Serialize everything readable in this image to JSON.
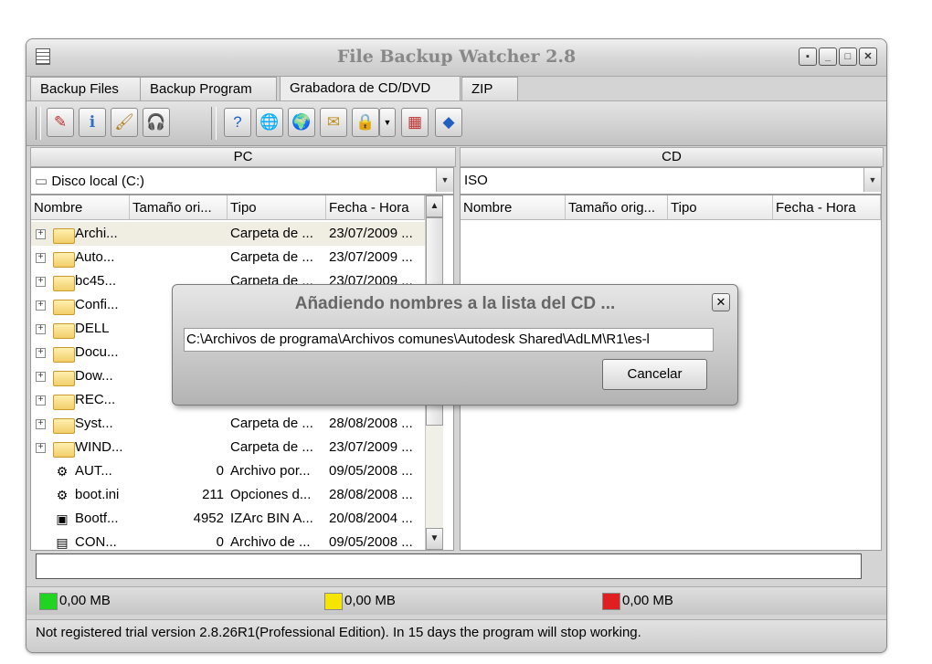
{
  "window": {
    "title": "File Backup Watcher 2.8"
  },
  "tabs": [
    "Backup Files",
    "Backup Program",
    "Grabadora de CD/DVD",
    "ZIP"
  ],
  "toolbar": {
    "buttons": [
      {
        "name": "burn-icon",
        "glyph": "✎",
        "color": "#c03030"
      },
      {
        "name": "info-icon",
        "glyph": "ℹ",
        "color": "#2f6fc0"
      },
      {
        "name": "brush-icon",
        "glyph": "🖌",
        "color": "#b08020"
      },
      {
        "name": "headset-icon",
        "glyph": "🎧",
        "color": "#3050b0"
      },
      {
        "name": "help-icon",
        "glyph": "?",
        "color": "#1f5fd0"
      },
      {
        "name": "globe-icon",
        "glyph": "🌐",
        "color": "#2f7f3f"
      },
      {
        "name": "world-icon",
        "glyph": "🌍",
        "color": "#2f7f3f"
      },
      {
        "name": "mail-icon",
        "glyph": "✉",
        "color": "#c09020"
      },
      {
        "name": "lock-icon",
        "glyph": "🔒",
        "color": "#c09020"
      },
      {
        "name": "puzzle-icon",
        "glyph": "▦",
        "color": "#c03030"
      },
      {
        "name": "diamond-icon",
        "glyph": "◆",
        "color": "#2060c0"
      }
    ]
  },
  "pc": {
    "header": "PC",
    "drive": "Disco local (C:)",
    "columns": [
      "Nombre",
      "Tamaño ori...",
      "Tipo",
      "Fecha - Hora"
    ],
    "rows": [
      {
        "kind": "folder",
        "name": "Archi...",
        "size": "",
        "type": "Carpeta de ...",
        "date": "23/07/2009 ..."
      },
      {
        "kind": "folder",
        "name": "Auto...",
        "size": "",
        "type": "Carpeta de ...",
        "date": "23/07/2009 ..."
      },
      {
        "kind": "folder",
        "name": "bc45...",
        "size": "",
        "type": "Carpeta de ...",
        "date": "23/07/2009 ..."
      },
      {
        "kind": "folder",
        "name": "Confi...",
        "size": "",
        "type": "",
        "date": ""
      },
      {
        "kind": "folder",
        "name": "DELL",
        "size": "",
        "type": "",
        "date": ""
      },
      {
        "kind": "folder",
        "name": "Docu...",
        "size": "",
        "type": "",
        "date": ""
      },
      {
        "kind": "folder",
        "name": "Dow...",
        "size": "",
        "type": "",
        "date": ""
      },
      {
        "kind": "folder",
        "name": "REC...",
        "size": "",
        "type": "",
        "date": ""
      },
      {
        "kind": "folder",
        "name": "Syst...",
        "size": "",
        "type": "Carpeta de ...",
        "date": "28/08/2008 ..."
      },
      {
        "kind": "folder",
        "name": "WIND...",
        "size": "",
        "type": "Carpeta de ...",
        "date": "23/07/2009 ..."
      },
      {
        "kind": "file",
        "icon": "⚙",
        "name": "AUT...",
        "size": "0",
        "type": "Archivo por...",
        "date": "09/05/2008 ..."
      },
      {
        "kind": "file",
        "icon": "⚙",
        "name": "boot.ini",
        "size": "211",
        "type": "Opciones d...",
        "date": "28/08/2008 ..."
      },
      {
        "kind": "file",
        "icon": "▣",
        "name": "Bootf...",
        "size": "4952",
        "type": "IZArc BIN A...",
        "date": "20/08/2004 ..."
      },
      {
        "kind": "file",
        "icon": "▤",
        "name": "CON...",
        "size": "0",
        "type": "Archivo de ...",
        "date": "09/05/2008 ..."
      }
    ]
  },
  "cd": {
    "header": "CD",
    "format": "ISO",
    "columns": [
      "Nombre",
      "Tamaño orig...",
      "Tipo",
      "Fecha - Hora"
    ]
  },
  "status": {
    "green_label": "0,00 MB",
    "yellow_label": "0,00 MB",
    "red_label": "0,00 MB",
    "colors": {
      "green": "#22d422",
      "yellow": "#f5e500",
      "red": "#e02020"
    }
  },
  "footer": {
    "text": "Not registered trial version 2.8.26R1(Professional Edition). In 15 days the program will stop working."
  },
  "dialog": {
    "title": "Añadiendo nombres a la lista del CD ...",
    "path": "C:\\Archivos de programa\\Archivos comunes\\Autodesk Shared\\AdLM\\R1\\es-l",
    "cancel": "Cancelar"
  }
}
